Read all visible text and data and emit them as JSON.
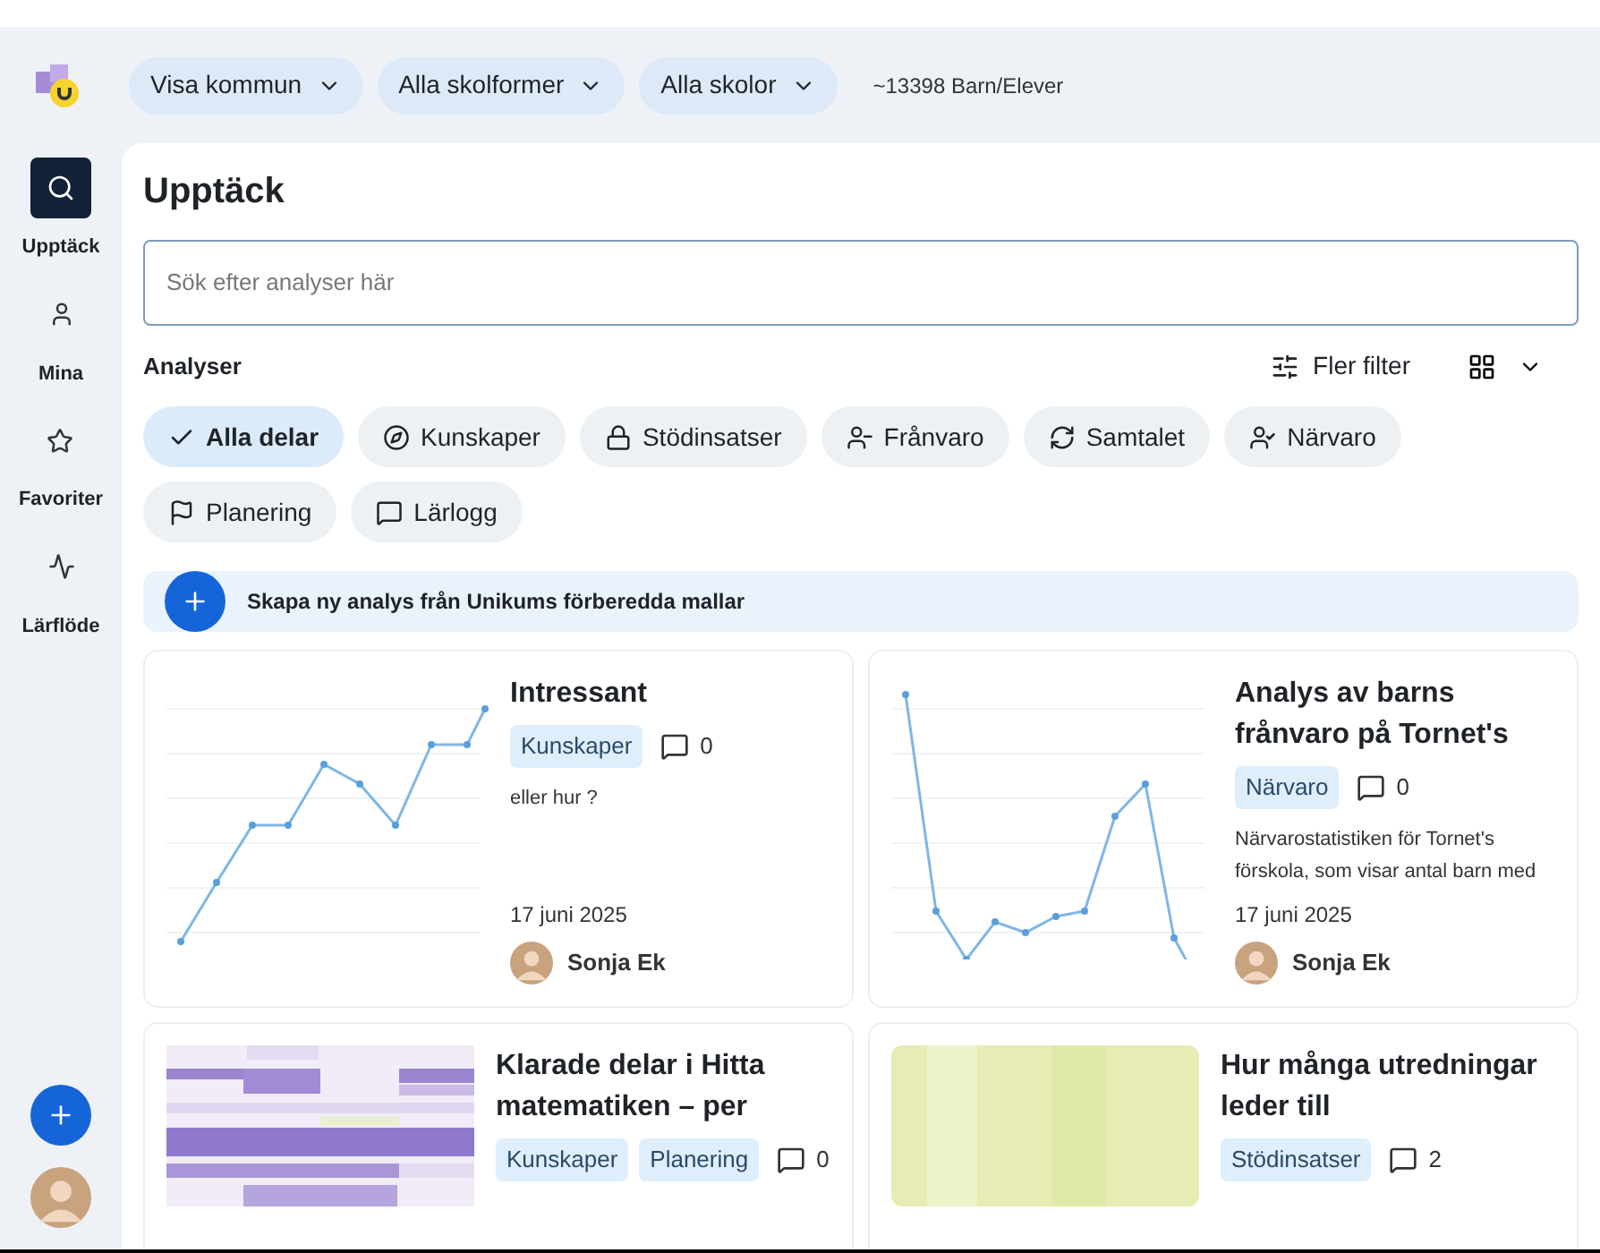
{
  "filters": [
    {
      "label": "Visa kommun"
    },
    {
      "label": "Alla skolformer"
    },
    {
      "label": "Alla skolor"
    }
  ],
  "count": "~13398 Barn/Elever",
  "sidebar": {
    "items": [
      {
        "label": "Upptäck",
        "selected": true
      },
      {
        "label": "Mina",
        "selected": false
      },
      {
        "label": "Favoriter",
        "selected": false
      },
      {
        "label": "Lärflöde",
        "selected": false
      }
    ]
  },
  "page_title": "Upptäck",
  "search": {
    "placeholder": "Sök efter analyser här"
  },
  "section_title": "Analyser",
  "more_filters": "Fler filter",
  "chips": [
    {
      "label": "Alla delar",
      "selected": true
    },
    {
      "label": "Kunskaper",
      "selected": false
    },
    {
      "label": "Stödinsatser",
      "selected": false
    },
    {
      "label": "Frånvaro",
      "selected": false
    },
    {
      "label": "Samtalet",
      "selected": false
    },
    {
      "label": "Närvaro",
      "selected": false
    },
    {
      "label": "Planering",
      "selected": false
    },
    {
      "label": "Lärlogg",
      "selected": false
    }
  ],
  "create_banner": "Skapa ny analys från Unikums förberedda mallar",
  "cards": [
    {
      "kind": "rising",
      "title": "Intressant",
      "tags": [
        "Kunskaper"
      ],
      "comments": "0",
      "description": "eller hur ?",
      "date": "17 juni 2025",
      "author": "Sonja Ek"
    },
    {
      "kind": "dip",
      "title": "Analys av barns frånvaro på Tornet's",
      "tags": [
        "Närvaro"
      ],
      "comments": "0",
      "description": "Närvarostatistiken för Tornet's förskola, som visar antal barn med",
      "date": "17 juni 2025",
      "author": "Sonja Ek"
    },
    {
      "kind": "heatmap",
      "title": "Klarade delar i Hitta matematiken – per",
      "tags": [
        "Kunskaper",
        "Planering"
      ],
      "comments": "0"
    },
    {
      "kind": "blocks",
      "title": "Hur många utredningar leder till",
      "tags": [
        "Stödinsatser"
      ],
      "comments": "2"
    }
  ]
}
